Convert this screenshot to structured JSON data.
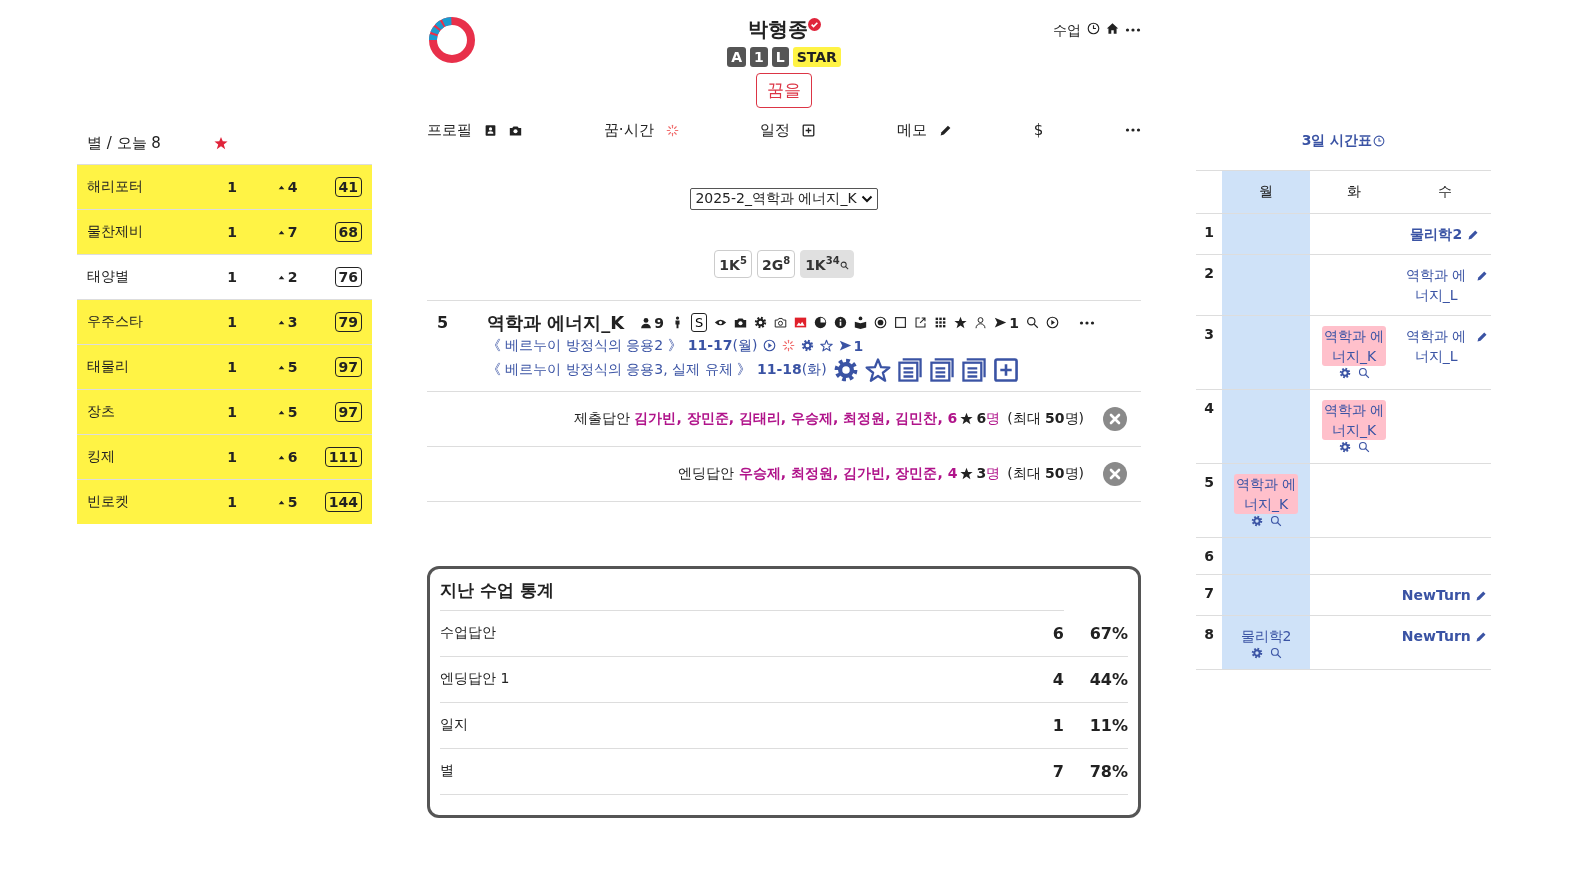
{
  "header": {
    "title": "박형종",
    "verified": true,
    "badges": [
      {
        "label": "A",
        "kind": "dark"
      },
      {
        "label": "1",
        "kind": "dark"
      },
      {
        "label": "L",
        "kind": "dark"
      },
      {
        "label": "STAR",
        "kind": "yellow"
      }
    ],
    "dream_button": "꿈을",
    "top_link": "수업"
  },
  "nav": [
    {
      "label": "프로필",
      "kind": "profile"
    },
    {
      "label": "꿈·시간",
      "kind": "dream"
    },
    {
      "label": "일정",
      "kind": "schedule"
    },
    {
      "label": "메모",
      "kind": "memo"
    },
    {
      "label": "$",
      "kind": "money"
    }
  ],
  "course_select": {
    "value": "2025-2_역학과 에너지_K"
  },
  "chips": [
    {
      "label": "1K",
      "sup": "5",
      "selected": false
    },
    {
      "label": "2G",
      "sup": "8",
      "selected": false
    },
    {
      "label": "1K",
      "sup": "34",
      "selected": true
    }
  ],
  "lesson": {
    "number": "5",
    "title": "역학과 에너지_K",
    "people_count": "9",
    "s_label": "S",
    "send_count": "1",
    "units": [
      {
        "title": "《 베르누이 방정식의 응용2 》",
        "date": "11-17",
        "weekday": "(월)",
        "kind": "small",
        "send_count": "1"
      },
      {
        "title": "《 베르누이 방정식의 응용3, 실제 유체 》",
        "date": "11-18",
        "weekday": "(화)",
        "kind": "large"
      }
    ]
  },
  "answers": [
    {
      "label": "제출답안",
      "names": "김가빈, 장민준, 김태리, 우승제, 최정원, 김민찬, 6",
      "star_count": "6",
      "unit": "명",
      "limit": "(최대 **50**명)"
    },
    {
      "label": "엔딩답안",
      "names": "우승제, 최정원, 김가빈, 장민준, 4",
      "star_count": "3",
      "unit": "명",
      "limit": "(최대 **50**명)"
    }
  ],
  "stats": {
    "title": "지난 수업 통계",
    "rows": [
      {
        "label": "수업답안",
        "count": "6",
        "percent": "67%"
      },
      {
        "label": "엔딩답안 1",
        "count": "4",
        "percent": "44%"
      },
      {
        "label": "일지",
        "count": "1",
        "percent": "11%"
      },
      {
        "label": "별",
        "count": "7",
        "percent": "78%"
      }
    ]
  },
  "stars_panel": {
    "title": "별 / 오늘 8",
    "rows": [
      {
        "name": "해리포터",
        "count": "1",
        "rise": "4",
        "total": "41",
        "highlighted": true
      },
      {
        "name": "물찬제비",
        "count": "1",
        "rise": "7",
        "total": "68",
        "highlighted": true
      },
      {
        "name": "태양별",
        "count": "1",
        "rise": "2",
        "total": "76",
        "highlighted": false
      },
      {
        "name": "우주스타",
        "count": "1",
        "rise": "3",
        "total": "79",
        "highlighted": true
      },
      {
        "name": "태물리",
        "count": "1",
        "rise": "5",
        "total": "97",
        "highlighted": true
      },
      {
        "name": "장츠",
        "count": "1",
        "rise": "5",
        "total": "97",
        "highlighted": true
      },
      {
        "name": "킹제",
        "count": "1",
        "rise": "6",
        "total": "111",
        "highlighted": true
      },
      {
        "name": "빈로켓",
        "count": "1",
        "rise": "5",
        "total": "144",
        "highlighted": true
      }
    ]
  },
  "timetable": {
    "title": "3일 시간표",
    "days": [
      {
        "label": "월",
        "selected": true
      },
      {
        "label": "화",
        "selected": false
      },
      {
        "label": "수",
        "selected": false
      }
    ],
    "rows": [
      {
        "period": "1",
        "cells": [
          null,
          null,
          {
            "kind": "note",
            "text": "물리학2",
            "bold": true
          }
        ]
      },
      {
        "period": "2",
        "cells": [
          null,
          null,
          {
            "kind": "note",
            "text": "역학과 에너지_L",
            "bold": false
          }
        ]
      },
      {
        "period": "3",
        "cells": [
          null,
          {
            "kind": "lesson",
            "text": "역학과 에너지_K",
            "highlighted": true
          },
          {
            "kind": "note",
            "text": "역학과 에너지_L",
            "bold": false
          }
        ]
      },
      {
        "period": "4",
        "cells": [
          null,
          {
            "kind": "lesson",
            "text": "역학과 에너지_K",
            "highlighted": true
          },
          null
        ]
      },
      {
        "period": "5",
        "cells": [
          {
            "kind": "lesson",
            "text": "역학과 에너지_K",
            "highlighted": true
          },
          null,
          null
        ]
      },
      {
        "period": "6",
        "cells": [
          null,
          null,
          null
        ]
      },
      {
        "period": "7",
        "cells": [
          null,
          null,
          {
            "kind": "note",
            "text": "NewTurn",
            "bold": true
          }
        ]
      },
      {
        "period": "8",
        "cells": [
          {
            "kind": "lesson",
            "text": "물리학2",
            "highlighted": false
          },
          null,
          {
            "kind": "note",
            "text": "NewTurn",
            "bold": true
          }
        ]
      }
    ]
  }
}
